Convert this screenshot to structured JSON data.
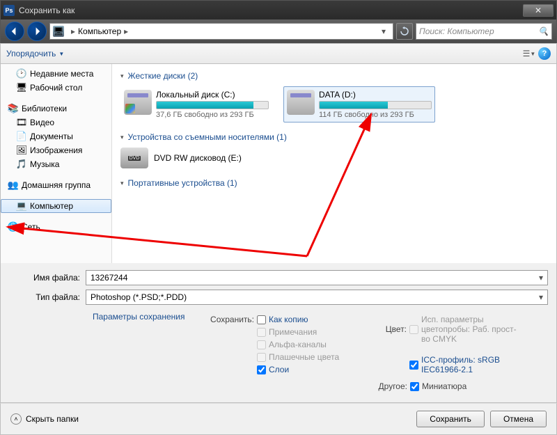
{
  "title": "Сохранить как",
  "breadcrumb": {
    "root_icon": "computer",
    "root": "Компьютер",
    "sep": "▸"
  },
  "search": {
    "placeholder": "Поиск: Компьютер"
  },
  "toolbar": {
    "organize": "Упорядочить"
  },
  "sidebar": {
    "recent": "Недавние места",
    "desktop": "Рабочий стол",
    "libraries": "Библиотеки",
    "video": "Видео",
    "documents": "Документы",
    "pictures": "Изображения",
    "music": "Музыка",
    "homegroup": "Домашняя группа",
    "computer": "Компьютер",
    "network": "Сеть"
  },
  "sections": {
    "hdd": "Жесткие диски (2)",
    "removable": "Устройства со съемными носителями (1)",
    "portable": "Портативные устройства (1)"
  },
  "drives": {
    "c": {
      "name": "Локальный диск (C:)",
      "free": "37,6 ГБ свободно из 293 ГБ",
      "fill": 87
    },
    "d": {
      "name": "DATA (D:)",
      "free": "114 ГБ свободно из 293 ГБ",
      "fill": 61
    },
    "dvd": {
      "name": "DVD RW дисковод (E:)"
    }
  },
  "fields": {
    "filename_label": "Имя файла:",
    "filename_value": "13267244",
    "filetype_label": "Тип файла:",
    "filetype_value": "Photoshop (*.PSD;*.PDD)"
  },
  "options": {
    "save_params": "Параметры сохранения",
    "save_label": "Сохранить:",
    "as_copy": "Как копию",
    "notes": "Примечания",
    "alpha": "Альфа-каналы",
    "spot": "Плашечные цвета",
    "layers": "Слои",
    "color_label": "Цвет:",
    "proof": "Исп. параметры цветопробы: Раб. прост-во CMYK",
    "icc": "ICC-профиль: sRGB IEC61966-2.1",
    "other_label": "Другое:",
    "thumb": "Миниатюра"
  },
  "footer": {
    "hide": "Скрыть папки",
    "save": "Сохранить",
    "cancel": "Отмена"
  }
}
